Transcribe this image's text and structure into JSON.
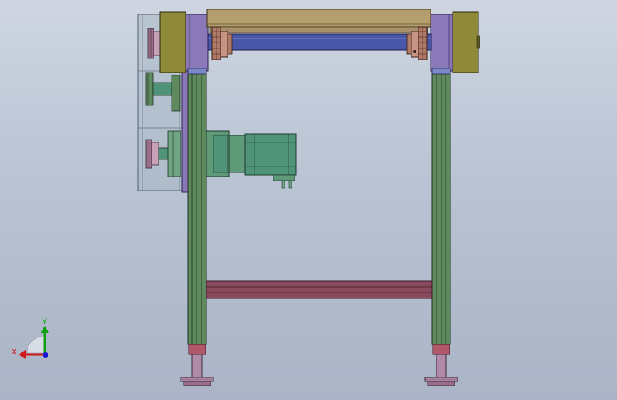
{
  "view": {
    "background_top": "#cfd6e2",
    "background_bottom": "#aab4c6"
  },
  "triad": {
    "x_label": "X",
    "y_label": "Y",
    "x_color": "#d01818",
    "y_color": "#10a010",
    "z_color": "#1818d0"
  },
  "colors": {
    "frame_green": "#5e8a5e",
    "bracket_purple": "#8a78b8",
    "top_plate_tan": "#b59e6e",
    "end_block_olive": "#8f8a3a",
    "roller_blue": "#4a56a8",
    "sprocket_copper": "#b07a68",
    "motor_teal": "#4f9479",
    "crossbar_maroon": "#8a4a5e",
    "foot_pink": "#b08aa8",
    "guard_gray": "#a8b8c4"
  }
}
